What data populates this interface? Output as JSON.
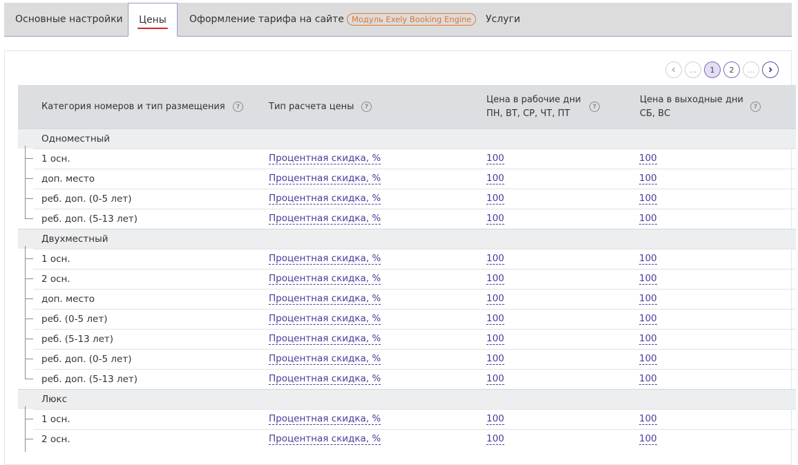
{
  "tabs": [
    {
      "label": "Основные настройки",
      "active": false
    },
    {
      "label": "Цены",
      "active": true
    },
    {
      "label": "Оформление тарифа на сайте",
      "badge": "Модуль Exely Booking Engine",
      "active": false
    },
    {
      "label": "Услуги",
      "active": false
    }
  ],
  "pager": {
    "prev_icon": "chevron-left-icon",
    "ellipsis_left": "...",
    "pages": [
      "1",
      "2"
    ],
    "current_page": "1",
    "ellipsis_right": "...",
    "next_icon": "chevron-right-icon"
  },
  "table": {
    "headers": {
      "category": "Категория номеров и тип размещения",
      "price_type": "Тип расчета цены",
      "weekday_line1": "Цена в рабочие дни",
      "weekday_line2": "ПН, ВТ, СР, ЧТ, ПТ",
      "weekend_line1": "Цена в выходные дни",
      "weekend_line2": "СБ, ВС",
      "help_glyph": "?"
    },
    "groups": [
      {
        "name": "Одноместный",
        "rows": [
          {
            "name": "1 осн.",
            "type": "Процентная скидка, %",
            "weekday": "100",
            "weekend": "100"
          },
          {
            "name": "доп. место",
            "type": "Процентная скидка, %",
            "weekday": "100",
            "weekend": "100"
          },
          {
            "name": "реб. доп. (0-5 лет)",
            "type": "Процентная скидка, %",
            "weekday": "100",
            "weekend": "100"
          },
          {
            "name": "реб. доп. (5-13 лет)",
            "type": "Процентная скидка, %",
            "weekday": "100",
            "weekend": "100"
          }
        ]
      },
      {
        "name": "Двухместный",
        "rows": [
          {
            "name": "1 осн.",
            "type": "Процентная скидка, %",
            "weekday": "100",
            "weekend": "100"
          },
          {
            "name": "2 осн.",
            "type": "Процентная скидка, %",
            "weekday": "100",
            "weekend": "100"
          },
          {
            "name": "доп. место",
            "type": "Процентная скидка, %",
            "weekday": "100",
            "weekend": "100"
          },
          {
            "name": "реб. (0-5 лет)",
            "type": "Процентная скидка, %",
            "weekday": "100",
            "weekend": "100"
          },
          {
            "name": "реб. (5-13 лет)",
            "type": "Процентная скидка, %",
            "weekday": "100",
            "weekend": "100"
          },
          {
            "name": "реб. доп. (0-5 лет)",
            "type": "Процентная скидка, %",
            "weekday": "100",
            "weekend": "100"
          },
          {
            "name": "реб. доп. (5-13 лет)",
            "type": "Процентная скидка, %",
            "weekday": "100",
            "weekend": "100"
          }
        ]
      },
      {
        "name": "Люкс",
        "rows": [
          {
            "name": "1 осн.",
            "type": "Процентная скидка, %",
            "weekday": "100",
            "weekend": "100"
          },
          {
            "name": "2 осн.",
            "type": "Процентная скидка, %",
            "weekday": "100",
            "weekend": "100"
          }
        ]
      }
    ]
  },
  "colors": {
    "accent": "#4a3a9a",
    "badge": "#e0752e",
    "active_underline": "#e02020"
  }
}
